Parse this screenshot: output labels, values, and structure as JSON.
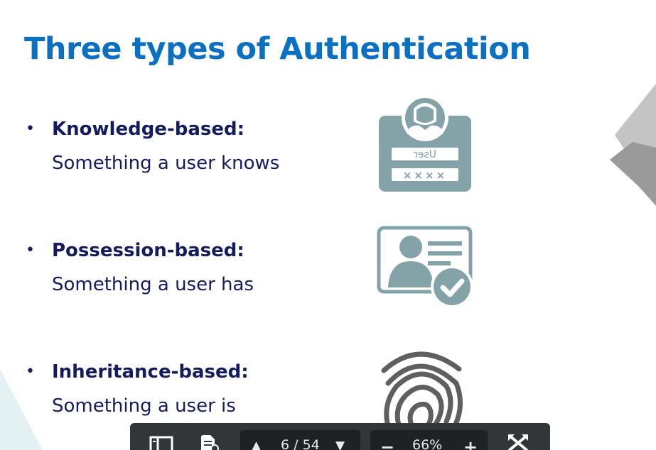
{
  "slide": {
    "title": "Three types of Authentication",
    "bullets": [
      {
        "heading": "Knowledge-based:",
        "description": "Something a user knows"
      },
      {
        "heading": "Possession-based:",
        "description": "Something a user has"
      },
      {
        "heading": "Inheritance-based:",
        "description": "Something a user is"
      }
    ],
    "login_card": {
      "user_text": "User",
      "password_text": "××××"
    }
  },
  "toolbar": {
    "page_indicator": "6 / 54",
    "zoom_level": "66%"
  },
  "colors": {
    "title": "#0b6fc2",
    "text": "#151c5e",
    "icon": "#84a3a8",
    "toolbar_bg": "#323639"
  }
}
